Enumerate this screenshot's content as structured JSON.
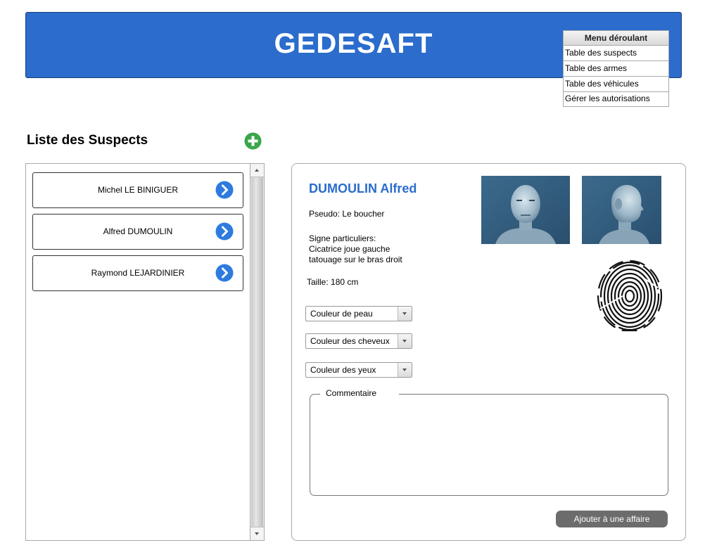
{
  "header": {
    "title": "GEDESAFT"
  },
  "menu": {
    "title": "Menu déroulant",
    "items": [
      {
        "label": "Table des suspects"
      },
      {
        "label": "Table des armes"
      },
      {
        "label": "Table des véhicules"
      },
      {
        "label": "Gérer les autorisations"
      }
    ]
  },
  "list": {
    "title": "Liste des Suspects",
    "add_icon": "plus-circle-icon",
    "suspects": [
      {
        "name": "Michel LE BINIGUER"
      },
      {
        "name": "Alfred DUMOULIN"
      },
      {
        "name": "Raymond LEJARDINIER"
      }
    ]
  },
  "detail": {
    "fullname": "DUMOULIN Alfred",
    "pseudo": "Pseudo: Le boucher",
    "signs_label": "Signe particuliers:",
    "signs_line1": "Cicatrice joue gauche",
    "signs_line2": "tatouage sur le bras droit",
    "height": "Taille: 180 cm",
    "selects": [
      {
        "value": "Couleur de peau"
      },
      {
        "value": "Couleur des cheveux"
      },
      {
        "value": "Couleur des yeux"
      }
    ],
    "comment_label": "Commentaire",
    "add_button": "Ajouter à une affaire"
  },
  "colors": {
    "header_bg": "#2b6ccc",
    "accent_text": "#2b6ccc",
    "arrow_button": "#2e7be0",
    "add_icon": "#3aa64a",
    "action_button_bg": "#6c6c6c"
  }
}
